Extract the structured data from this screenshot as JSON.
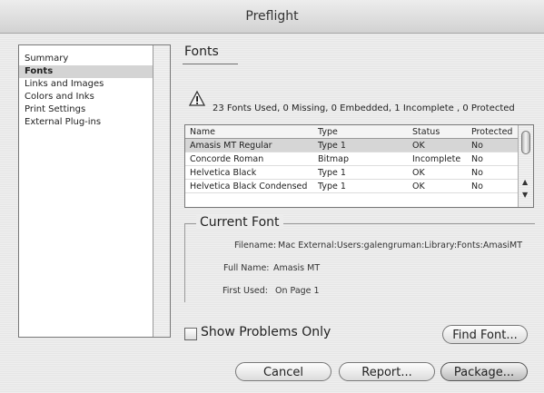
{
  "window": {
    "title": "Preflight"
  },
  "sidebar": {
    "items": [
      {
        "label": "Summary",
        "selected": false
      },
      {
        "label": "Fonts",
        "selected": true
      },
      {
        "label": "Links and Images",
        "selected": false
      },
      {
        "label": "Colors and Inks",
        "selected": false
      },
      {
        "label": "Print Settings",
        "selected": false
      },
      {
        "label": "External Plug-ins",
        "selected": false
      }
    ]
  },
  "main": {
    "section_title": "Fonts",
    "summary": "23 Fonts Used, 0 Missing, 0 Embedded, 1 Incomplete , 0 Protected",
    "table": {
      "columns": [
        "Name",
        "Type",
        "Status",
        "Protected"
      ],
      "rows": [
        [
          "Amasis MT Regular",
          "Type 1",
          "OK",
          "No"
        ],
        [
          "Concorde Roman",
          "Bitmap",
          "Incomplete",
          "No"
        ],
        [
          "Helvetica Black",
          "Type 1",
          "OK",
          "No"
        ],
        [
          "Helvetica Black Condensed",
          "Type 1",
          "OK",
          "No"
        ]
      ],
      "selected_row": 0
    },
    "current_font": {
      "title": "Current Font",
      "filename_label": "Filename:",
      "filename_value": "Mac External:Users:galengruman:Library:Fonts:AmasiMT",
      "fullname_label": "Full Name:",
      "fullname_value": "Amasis MT",
      "firstused_label": "First Used:",
      "firstused_value": "On Page 1"
    },
    "show_problems_label": "Show Problems Only",
    "show_problems_checked": false,
    "find_font_label": "Find Font...",
    "cancel_label": "Cancel",
    "report_label": "Report...",
    "package_label": "Package..."
  }
}
